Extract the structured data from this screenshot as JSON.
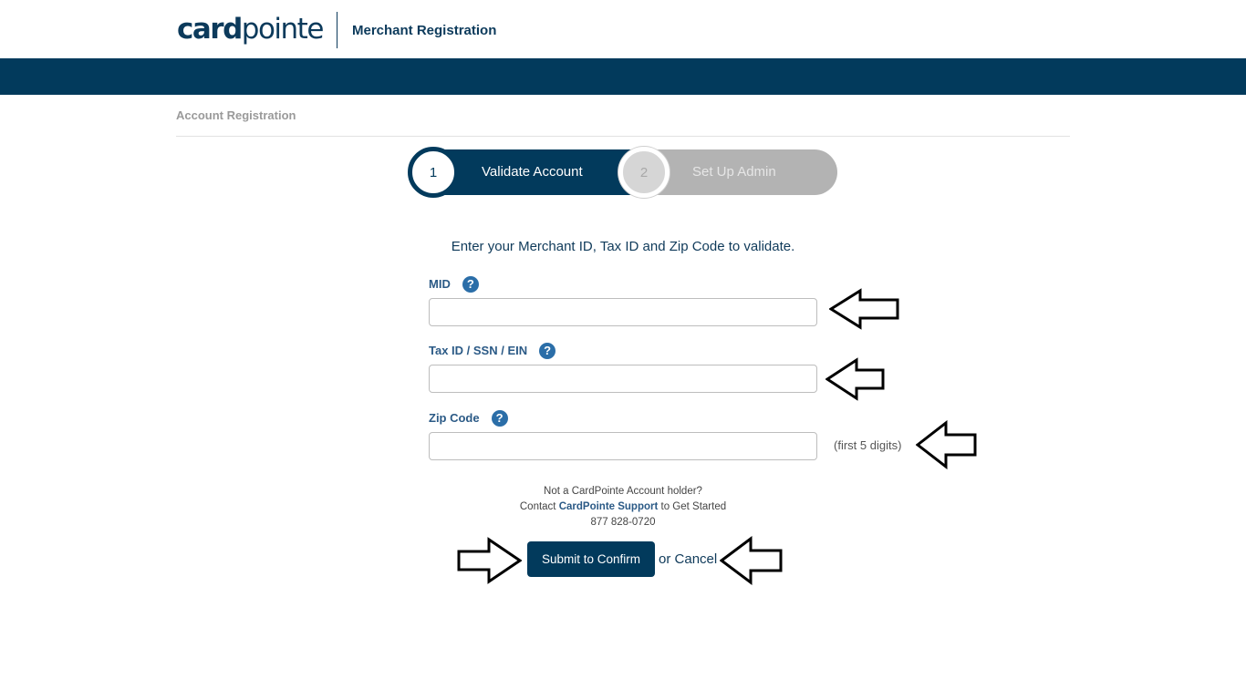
{
  "header": {
    "logo_bold": "card",
    "logo_light": "pointe",
    "title": "Merchant Registration"
  },
  "breadcrumb": "Account Registration",
  "steps": [
    {
      "number": "1",
      "label": "Validate Account",
      "active": true
    },
    {
      "number": "2",
      "label": "Set Up Admin",
      "active": false
    }
  ],
  "form": {
    "instructions": "Enter your Merchant ID, Tax ID and Zip Code to validate.",
    "mid": {
      "label": "MID",
      "value": "",
      "help_icon": "question-circle-icon"
    },
    "tax_id": {
      "label": "Tax ID / SSN / EIN",
      "value": "",
      "help_icon": "question-circle-icon"
    },
    "zip": {
      "label": "Zip Code",
      "value": "",
      "hint": "(first 5 digits)",
      "help_icon": "question-circle-icon"
    },
    "help_glyph": "?"
  },
  "support": {
    "line1": "Not a CardPointe Account holder?",
    "line2_prefix": "Contact ",
    "line2_link": "CardPointe Support",
    "line2_suffix": " to Get Started",
    "phone": "877 828-0720"
  },
  "actions": {
    "submit_label": "Submit to Confirm",
    "or_text": "or ",
    "cancel_label": "Cancel"
  },
  "annotations": {
    "arrow_icon": "outline-arrow-icon",
    "arrow_fill": "#ffffff",
    "arrow_stroke": "#000000"
  },
  "colors": {
    "brand_navy": "#023a5c",
    "label_blue": "#2b5a86",
    "inactive_gray": "#b3b3b3"
  }
}
